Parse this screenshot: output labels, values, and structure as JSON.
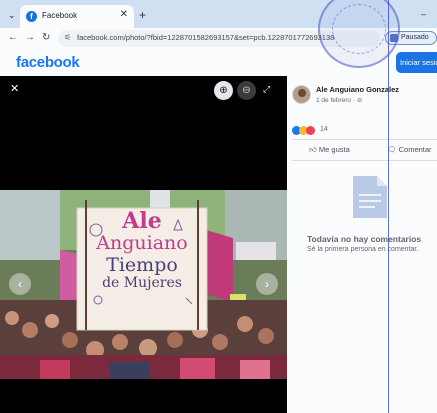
{
  "browser": {
    "tab_title": "Facebook",
    "favicon_letter": "f",
    "url": "facebook.com/photo/?fbid=1228701582693157&set=pcb.1228701772693138",
    "profile_status": "Pausado"
  },
  "header": {
    "logo": "facebook",
    "login_button": "Iniciar sesión"
  },
  "post": {
    "author": "Ale Anguiano Gonzalez",
    "date": "1 de febrero · ⊘",
    "reaction_count": "14",
    "like_label": "Me gusta",
    "comment_label": "Comentar",
    "empty_title": "Todavía no hay comentarios",
    "empty_subtitle": "Sé la primera persona en comentar."
  },
  "photo": {
    "banner_lines": [
      "Ale",
      "Anguiano",
      "Tiempo",
      "de Mujeres"
    ]
  },
  "colors": {
    "brand": "#1877f2",
    "viewer_bg": "#000000",
    "banner_text": "#c43a8e"
  }
}
